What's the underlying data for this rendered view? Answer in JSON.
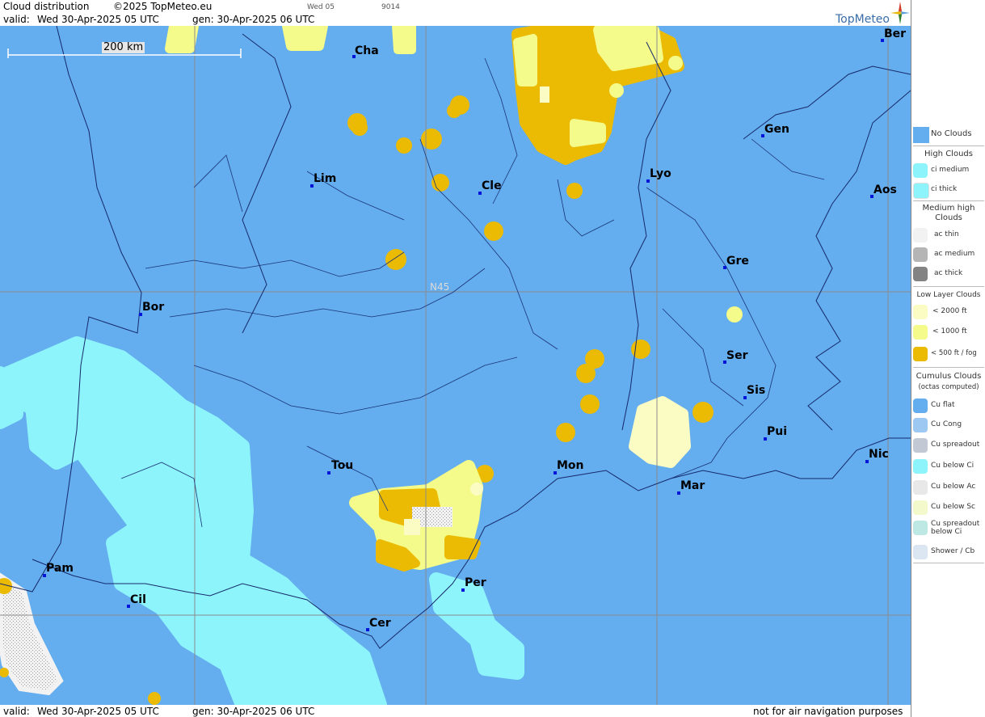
{
  "header": {
    "title": "Cloud distribution",
    "copyright": "©2025 TopMeteo.eu",
    "small_left": "Wed 05",
    "small_right": "9014",
    "valid_label": "valid:",
    "valid_time": "Wed  30-Apr-2025  05 UTC",
    "gen_time": "gen: 30-Apr-2025 06 UTC",
    "brand": "TopMeteo"
  },
  "footer": {
    "valid_label": "valid:",
    "valid_time": "Wed  30-Apr-2025  05 UTC",
    "gen_time": "gen: 30-Apr-2025 06 UTC",
    "disclaimer": "not for air navigation purposes"
  },
  "map": {
    "scale_label": "200 km",
    "lat_label": "N45",
    "cities": [
      {
        "name": "Cha"
      },
      {
        "name": "Ber"
      },
      {
        "name": "Gen"
      },
      {
        "name": "Lim"
      },
      {
        "name": "Cle"
      },
      {
        "name": "Lyo"
      },
      {
        "name": "Aos"
      },
      {
        "name": "Gre"
      },
      {
        "name": "Bor"
      },
      {
        "name": "Ser"
      },
      {
        "name": "Sis"
      },
      {
        "name": "Pui"
      },
      {
        "name": "Tou"
      },
      {
        "name": "Mon"
      },
      {
        "name": "Mar"
      },
      {
        "name": "Nic"
      },
      {
        "name": "Pam"
      },
      {
        "name": "Per"
      },
      {
        "name": "Cil"
      },
      {
        "name": "Cer"
      }
    ]
  },
  "legend": {
    "no_clouds": "No Clouds",
    "high_clouds": "High Clouds",
    "ci_medium": "ci medium",
    "ci_thick": "ci thick",
    "medium_high": "Medium high Clouds",
    "ac_thin": "ac thin",
    "ac_medium": "ac medium",
    "ac_thick": "ac thick",
    "low_layer": "Low Layer Clouds",
    "lt2000": "< 2000 ft",
    "lt1000": "< 1000 ft",
    "lt500": "< 500 ft / fog",
    "cumulus": "Cumulus Clouds",
    "octas": "(octas computed)",
    "cu_flat": "Cu flat",
    "cu_cong": "Cu Cong",
    "cu_spreadout": "Cu spreadout",
    "cu_below_ci": "Cu below Ci",
    "cu_below_ac": "Cu below Ac",
    "cu_below_sc": "Cu below Sc",
    "cu_spreadout_below_ci": "Cu spreadout below Ci",
    "shower": "Shower / Cb"
  },
  "colors": {
    "no_clouds": "#64adee",
    "ci": "#8ef4fb",
    "low_2000": "#fbfbc4",
    "low_1000": "#f4fb8a",
    "low_500": "#ebbb04",
    "grid": "#8c8c8c",
    "city_dot": "#0015d8"
  }
}
